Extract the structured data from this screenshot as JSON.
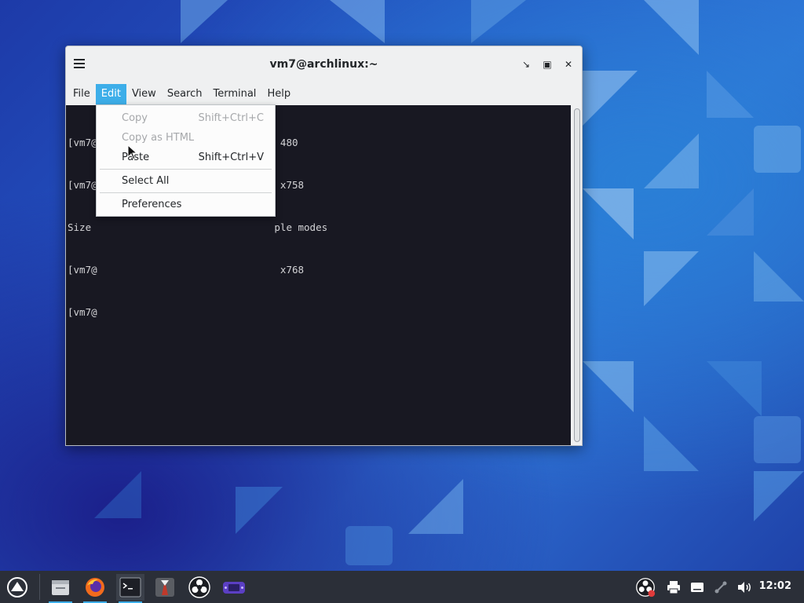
{
  "window": {
    "title": "vm7@archlinux:~",
    "menu": [
      "File",
      "Edit",
      "View",
      "Search",
      "Terminal",
      "Help"
    ],
    "active_menu": "Edit"
  },
  "terminal": {
    "lines": [
      "[vm7@                               480",
      "[vm7@                               x758",
      "Size                               ple modes",
      "[vm7@                               x768",
      "[vm7@"
    ]
  },
  "edit_menu": {
    "items": [
      {
        "label": "Copy",
        "shortcut": "Shift+Ctrl+C",
        "disabled": true
      },
      {
        "label": "Copy as HTML",
        "shortcut": "",
        "disabled": true
      },
      {
        "label": "Paste",
        "shortcut": "Shift+Ctrl+V",
        "disabled": false
      },
      {
        "label": "Select All",
        "shortcut": "",
        "disabled": false
      },
      {
        "label": "Preferences",
        "shortcut": "",
        "disabled": false
      }
    ]
  },
  "taskbar": {
    "launchers": [
      "app-launcher-icon",
      "file-manager-icon",
      "firefox-icon",
      "terminal-icon",
      "tux-app-icon",
      "obs-icon",
      "game-app-icon"
    ],
    "tray": [
      "obs-tray-icon",
      "printer-icon",
      "keyboard-icon",
      "network-icon",
      "volume-icon"
    ],
    "clock": "12:02"
  },
  "colors": {
    "accent": "#3daee9",
    "terminal_bg": "#181822",
    "taskbar_bg": "#2b2f38"
  }
}
